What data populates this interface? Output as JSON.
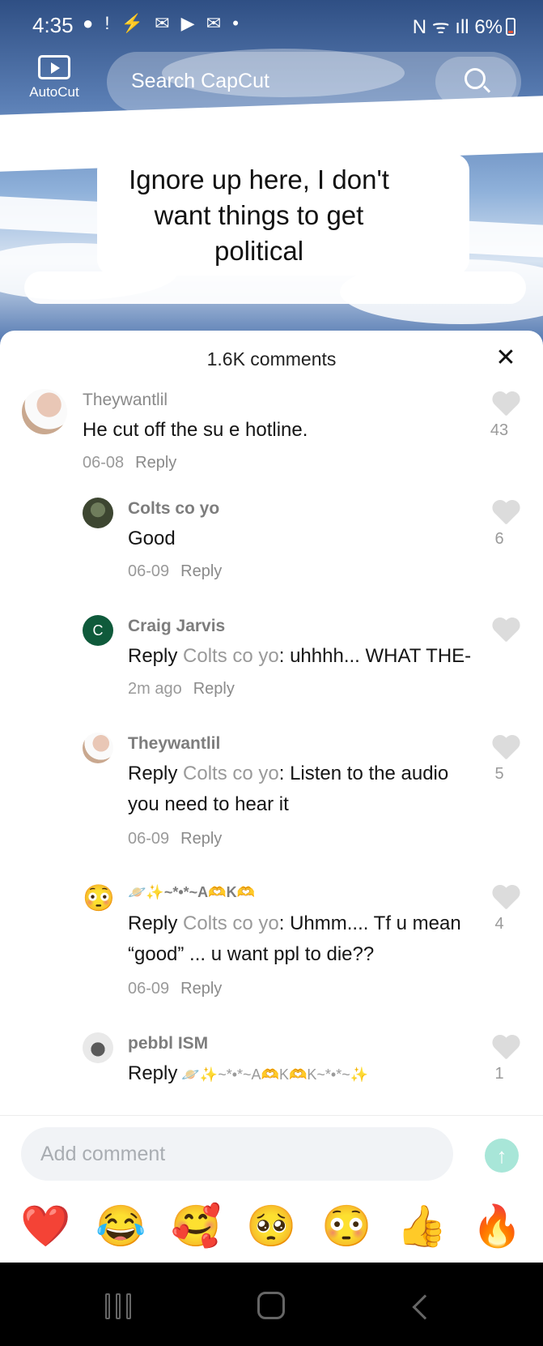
{
  "status_bar": {
    "time": "4:35",
    "left_icons": "● ! ⚡ ✉ ▶ ✉ •",
    "right_icons": "N ᯤ ıll",
    "battery": "6%"
  },
  "header": {
    "autocut_label": "AutoCut",
    "search_placeholder": "Search CapCut"
  },
  "video": {
    "caption": "Ignore up here, I don't want things to get political"
  },
  "comments_sheet": {
    "title": "1.6K comments",
    "comments": [
      {
        "user": "Theywantlil",
        "text": "He cut off the su    e hotline.",
        "date": "06-08",
        "reply_label": "Reply",
        "likes": "43"
      },
      {
        "user": "Colts co yo",
        "text": "Good",
        "date": "06-09",
        "reply_label": "Reply",
        "likes": "6"
      },
      {
        "user": "Craig Jarvis",
        "avatar_letter": "C",
        "reply_word": "Reply",
        "reply_to": "Colts co yo",
        "text": ": uhhhh... WHAT THE-",
        "date": "2m ago",
        "reply_label": "Reply",
        "likes": ""
      },
      {
        "user": "Theywantlil",
        "reply_word": "Reply",
        "reply_to": "Colts co yo",
        "text_line1": ": Listen to the audio",
        "text_line2": "you need to hear it",
        "date": "06-09",
        "reply_label": "Reply",
        "likes": "5"
      },
      {
        "user": "🪐✨~*•*~A🫶K🫶",
        "avatar_emoji": "😳",
        "reply_word": "Reply",
        "reply_to": "Colts co yo",
        "text_line1": ": Uhmm.... Tf u mean",
        "text_line2": "“good” ... u want ppl to die??",
        "date": "06-09",
        "reply_label": "Reply",
        "likes": "4"
      },
      {
        "user": "pebbl ISM",
        "reply_word": "Reply",
        "reply_to": "🪐✨~*•*~A🫶K🫶K~*•*~✨",
        "likes": "1"
      }
    ],
    "input_placeholder": "Add comment",
    "quick_emojis": [
      "❤️",
      "😂",
      "🥰",
      "🥺",
      "😳",
      "👍",
      "🔥"
    ]
  },
  "colors": {
    "accent_send": "#a8e6d8",
    "craig_avatar": "#0f5a3b"
  }
}
